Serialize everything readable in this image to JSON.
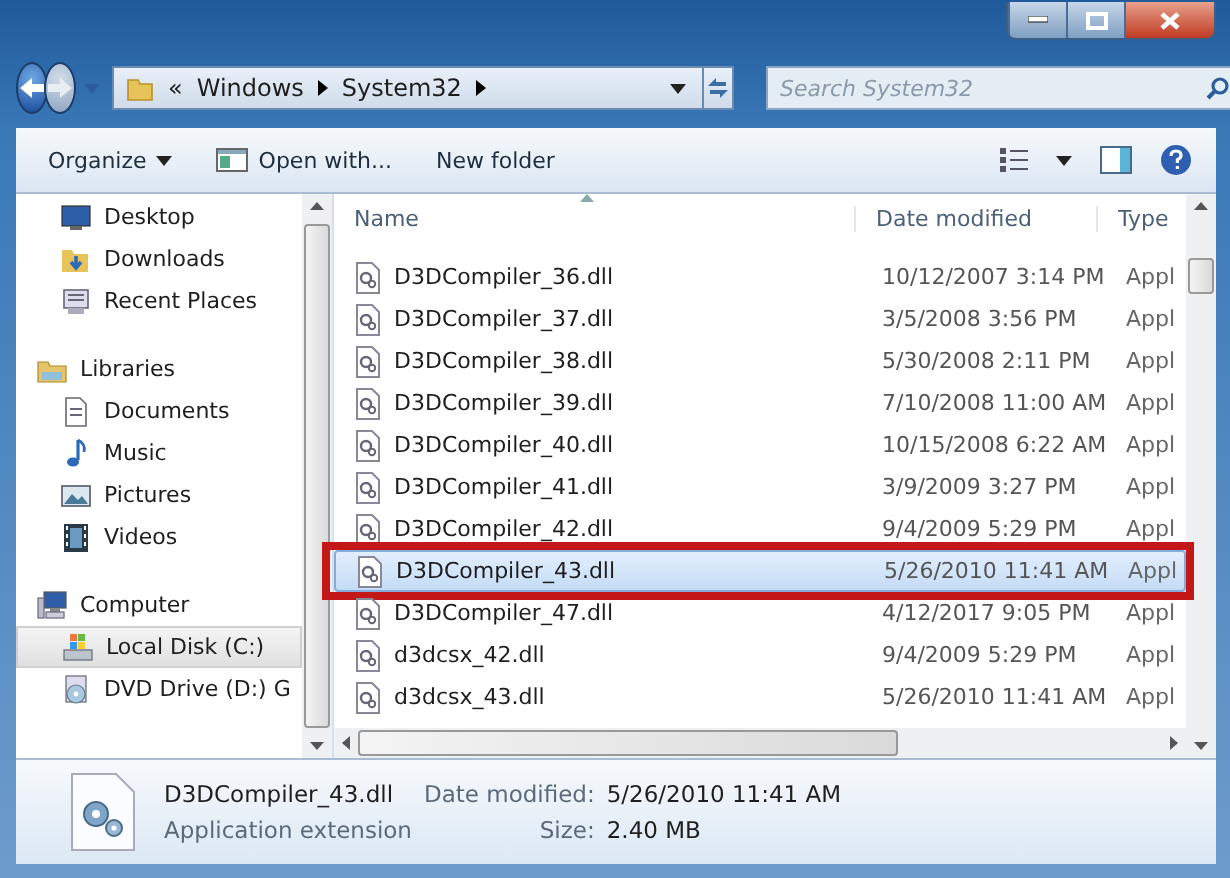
{
  "address": {
    "crumbs": [
      "«",
      "Windows",
      "System32"
    ],
    "search_placeholder": "Search System32"
  },
  "toolbar": {
    "organize": "Organize",
    "open_with": "Open with...",
    "new_folder": "New folder"
  },
  "sidebar": {
    "groups": [
      {
        "children": [
          {
            "label": "Desktop",
            "kind": "desktop",
            "selected": false
          },
          {
            "label": "Downloads",
            "kind": "downloads",
            "selected": false
          },
          {
            "label": "Recent Places",
            "kind": "recent",
            "selected": false
          }
        ]
      },
      {
        "label": "Libraries",
        "kind": "library",
        "children": [
          {
            "label": "Documents",
            "kind": "document",
            "selected": false
          },
          {
            "label": "Music",
            "kind": "music",
            "selected": false
          },
          {
            "label": "Pictures",
            "kind": "pictures",
            "selected": false
          },
          {
            "label": "Videos",
            "kind": "videos",
            "selected": false
          }
        ]
      },
      {
        "label": "Computer",
        "kind": "computer",
        "children": [
          {
            "label": "Local Disk (C:)",
            "kind": "disk",
            "selected": true
          },
          {
            "label": "DVD Drive (D:) G",
            "kind": "dvd",
            "selected": false
          }
        ]
      }
    ]
  },
  "file_list": {
    "columns": [
      "Name",
      "Date modified",
      "Type"
    ],
    "rows": [
      {
        "name": "D3DCompiler_36.dll",
        "date": "10/12/2007 3:14 PM",
        "type": "Appl",
        "selected": false,
        "annotated": false
      },
      {
        "name": "D3DCompiler_37.dll",
        "date": "3/5/2008 3:56 PM",
        "type": "Appl",
        "selected": false,
        "annotated": false
      },
      {
        "name": "D3DCompiler_38.dll",
        "date": "5/30/2008 2:11 PM",
        "type": "Appl",
        "selected": false,
        "annotated": false
      },
      {
        "name": "D3DCompiler_39.dll",
        "date": "7/10/2008 11:00 AM",
        "type": "Appl",
        "selected": false,
        "annotated": false
      },
      {
        "name": "D3DCompiler_40.dll",
        "date": "10/15/2008 6:22 AM",
        "type": "Appl",
        "selected": false,
        "annotated": false
      },
      {
        "name": "D3DCompiler_41.dll",
        "date": "3/9/2009 3:27 PM",
        "type": "Appl",
        "selected": false,
        "annotated": false
      },
      {
        "name": "D3DCompiler_42.dll",
        "date": "9/4/2009 5:29 PM",
        "type": "Appl",
        "selected": false,
        "annotated": false
      },
      {
        "name": "D3DCompiler_43.dll",
        "date": "5/26/2010 11:41 AM",
        "type": "Appl",
        "selected": true,
        "annotated": true
      },
      {
        "name": "D3DCompiler_47.dll",
        "date": "4/12/2017 9:05 PM",
        "type": "Appl",
        "selected": false,
        "annotated": false
      },
      {
        "name": "d3dcsx_42.dll",
        "date": "9/4/2009 5:29 PM",
        "type": "Appl",
        "selected": false,
        "annotated": false
      },
      {
        "name": "d3dcsx_43.dll",
        "date": "5/26/2010 11:41 AM",
        "type": "Appl",
        "selected": false,
        "annotated": false
      }
    ]
  },
  "details": {
    "name": "D3DCompiler_43.dll",
    "type": "Application extension",
    "date_label": "Date modified:",
    "date": "5/26/2010 11:41 AM",
    "size_label": "Size:",
    "size": "2.40 MB"
  }
}
